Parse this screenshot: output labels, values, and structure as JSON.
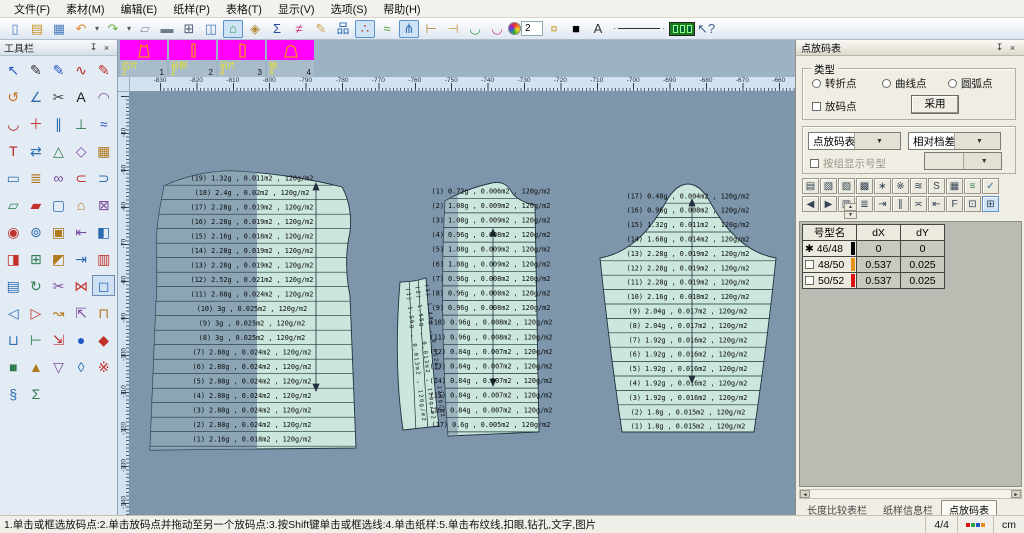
{
  "menu_bar": {
    "items": [
      "文件(F)",
      "素材(M)",
      "编辑(E)",
      "纸样(P)",
      "表格(T)",
      "显示(V)",
      "选项(S)",
      "帮助(H)"
    ]
  },
  "main_toolbar": {
    "zoom_value": "2",
    "icons": [
      {
        "n": "new-file-icon",
        "g": "▯",
        "c": "#4a7ebb"
      },
      {
        "n": "open-file-icon",
        "g": "▤",
        "c": "#c9972f"
      },
      {
        "n": "save-icon",
        "g": "▦",
        "c": "#4a7ebb"
      },
      {
        "n": "undo-icon",
        "g": "↶",
        "c": "#e08a2e"
      },
      {
        "n": "undo-dropdown-icon",
        "g": "▾",
        "c": "#555",
        "narrow": true
      },
      {
        "n": "redo-icon",
        "g": "↷",
        "c": "#74b043"
      },
      {
        "n": "redo-dropdown-icon",
        "g": "▾",
        "c": "#555",
        "narrow": true
      },
      {
        "n": "eraser-icon",
        "g": "▱",
        "c": "#8a97a5"
      },
      {
        "n": "plotter-icon",
        "g": "▬",
        "c": "#6b7b8c"
      },
      {
        "n": "grid-table-icon",
        "g": "⊞",
        "c": "#51617a"
      },
      {
        "n": "pattern-window-icon",
        "g": "◫",
        "c": "#4a7ebb"
      },
      {
        "n": "work-piece-icon",
        "g": "⌂",
        "c": "#2f9e44",
        "sel": true
      },
      {
        "n": "lock-icon",
        "g": "◈",
        "c": "#b08c3a"
      },
      {
        "n": "sum-icon",
        "g": "Σ",
        "c": "#2b4c9b"
      },
      {
        "n": "color-lines-icon",
        "g": "≠",
        "c": "#d63384"
      },
      {
        "n": "brush-icon",
        "g": "✎",
        "c": "#caa24a"
      },
      {
        "n": "tree-chart-icon",
        "g": "品",
        "c": "#2b6cb0"
      },
      {
        "n": "point-plot-icon",
        "g": "∴",
        "c": "#c2302a",
        "sel": true
      },
      {
        "n": "curve-lines-icon",
        "g": "≈",
        "c": "#5f9e44"
      },
      {
        "n": "drill-tool-icon",
        "g": "⋔",
        "c": "#2b6cb0",
        "sel": true
      },
      {
        "n": "measure-a-icon",
        "g": "⊢",
        "c": "#b08c3a"
      },
      {
        "n": "measure-b-icon",
        "g": "⊣",
        "c": "#caa24a"
      },
      {
        "n": "u-curve-icon",
        "g": "◡",
        "c": "#2f9e44"
      },
      {
        "n": "u-curve2-icon",
        "g": "◡",
        "c": "#d63384"
      },
      {
        "n": "color-wheel-icon",
        "special": "wheel"
      },
      {
        "n": "zoom-level-input",
        "special": "input"
      },
      {
        "n": "bulb-icon",
        "g": "¤",
        "c": "#c9a227"
      },
      {
        "n": "color-swatch-icon",
        "g": "■",
        "c": "#000000"
      },
      {
        "n": "text-tool-icon",
        "g": "A",
        "c": "#333333"
      },
      {
        "n": "line-style-select",
        "special": "line"
      },
      {
        "n": "film-icon",
        "special": "film"
      },
      {
        "n": "context-help-icon",
        "g": "↖?",
        "c": "#44608c"
      }
    ]
  },
  "tool_palette": {
    "title": "工具栏",
    "icons": [
      {
        "n": "select-arrow-icon",
        "g": "↖",
        "c": "#2457c5"
      },
      {
        "n": "pen-point-icon",
        "g": "✎",
        "c": "#333333"
      },
      {
        "n": "pen-line-icon",
        "g": "✎",
        "c": "#2457c5"
      },
      {
        "n": "wave-curve-icon",
        "g": "∿",
        "c": "#b3261e"
      },
      {
        "n": "red-pencil-icon",
        "g": "✎",
        "c": "#c2302a"
      },
      {
        "n": "rotate-arrow-icon",
        "g": "↺",
        "c": "#d07020"
      },
      {
        "n": "angle-tool-icon",
        "g": "∠",
        "c": "#2b6cb0"
      },
      {
        "n": "scissors-icon",
        "g": "✂",
        "c": "#444444"
      },
      {
        "n": "text-a-icon",
        "g": "A",
        "c": "#1a1a1a"
      },
      {
        "n": "arc-top-icon",
        "g": "◠",
        "c": "#7a4b9e"
      },
      {
        "n": "arc-bottom-icon",
        "g": "◡",
        "c": "#b3261e"
      },
      {
        "n": "add-point-icon",
        "g": "＋",
        "c": "#c2302a"
      },
      {
        "n": "parallel-icon",
        "g": "∥",
        "c": "#2b6cb0"
      },
      {
        "n": "perpendicular-icon",
        "g": "⊥",
        "c": "#2f7d4f"
      },
      {
        "n": "smooth-wave-icon",
        "g": "≈",
        "c": "#2457c5"
      },
      {
        "n": "t-square-icon",
        "g": "T",
        "c": "#b3261e"
      },
      {
        "n": "mirror-swap-icon",
        "g": "⇄",
        "c": "#2b6cb0"
      },
      {
        "n": "triangle-icon",
        "g": "△",
        "c": "#2f7d4f"
      },
      {
        "n": "diamond-icon",
        "g": "◇",
        "c": "#7a4b9e"
      },
      {
        "n": "grid-fill-icon",
        "g": "▦",
        "c": "#b07a1e"
      },
      {
        "n": "rect-tool-icon",
        "g": "▭",
        "c": "#2b6cb0"
      },
      {
        "n": "stack-lines-icon",
        "g": "≣",
        "c": "#b07a1e"
      },
      {
        "n": "infinity-icon",
        "g": "∞",
        "c": "#7a4b9e"
      },
      {
        "n": "subset-left-icon",
        "g": "⊂",
        "c": "#c2302a"
      },
      {
        "n": "subset-right-icon",
        "g": "⊃",
        "c": "#2b6cb0"
      },
      {
        "n": "piece-outline-icon",
        "g": "▱",
        "c": "#2f7d4f"
      },
      {
        "n": "piece-filled-icon",
        "g": "▰",
        "c": "#c2302a"
      },
      {
        "n": "square-tool-icon",
        "g": "▢",
        "c": "#2b6cb0"
      },
      {
        "n": "house-piece-icon",
        "g": "⌂",
        "c": "#b07a1e"
      },
      {
        "n": "boxed-x-icon",
        "g": "⊠",
        "c": "#7a4b9e"
      },
      {
        "n": "target-icon",
        "g": "◉",
        "c": "#c2302a"
      },
      {
        "n": "ring-icon",
        "g": "⊚",
        "c": "#2b6cb0"
      },
      {
        "n": "filled-box-icon",
        "g": "▣",
        "c": "#b07a1e"
      },
      {
        "n": "tab-left-icon",
        "g": "⇤",
        "c": "#7a4b9e"
      },
      {
        "n": "half-left-icon",
        "g": "◧",
        "c": "#2b6cb0"
      },
      {
        "n": "half-right-icon",
        "g": "◨",
        "c": "#c2302a"
      },
      {
        "n": "boxed-plus-icon",
        "g": "⊞",
        "c": "#2f7d4f"
      },
      {
        "n": "half-top-icon",
        "g": "◩",
        "c": "#b07a1e"
      },
      {
        "n": "tab-right-icon",
        "g": "⇥",
        "c": "#2b6cb0"
      },
      {
        "n": "vertical-fill-icon",
        "g": "▥",
        "c": "#c2302a"
      },
      {
        "n": "horizontal-fill-icon",
        "g": "▤",
        "c": "#2b6cb0"
      },
      {
        "n": "refresh-icon",
        "g": "↻",
        "c": "#2f7d4f"
      },
      {
        "n": "cut-pattern-icon",
        "g": "✂",
        "c": "#7a4b9e"
      },
      {
        "n": "join-bowtie-icon",
        "g": "⋈",
        "c": "#c2302a"
      },
      {
        "n": "box-select-icon",
        "g": "◻",
        "c": "#2b6cb0",
        "sel": true
      },
      {
        "n": "tri-left-icon",
        "g": "◁",
        "c": "#2b6cb0"
      },
      {
        "n": "tri-right-icon",
        "g": "▷",
        "c": "#c2302a"
      },
      {
        "n": "squiggle-arrow-icon",
        "g": "↝",
        "c": "#b07a1e"
      },
      {
        "n": "corner-in-icon",
        "g": "⇱",
        "c": "#7a4b9e"
      },
      {
        "n": "cap-icon",
        "g": "⊓",
        "c": "#b07a1e"
      },
      {
        "n": "cup-icon",
        "g": "⊔",
        "c": "#2b6cb0"
      },
      {
        "n": "turnstile-icon",
        "g": "⊢",
        "c": "#2f7d4f"
      },
      {
        "n": "corner-out-icon",
        "g": "⇲",
        "c": "#c2302a"
      },
      {
        "n": "dot-tool-icon",
        "g": "●",
        "c": "#2457c5"
      },
      {
        "n": "diamond-filled-icon",
        "g": "◆",
        "c": "#c2302a"
      },
      {
        "n": "square-filled-icon",
        "g": "■",
        "c": "#2f7d4f"
      },
      {
        "n": "triangle-up-icon",
        "g": "▲",
        "c": "#b07a1e"
      },
      {
        "n": "triangle-down-icon",
        "g": "▽",
        "c": "#7a4b9e"
      },
      {
        "n": "lozenge-icon",
        "g": "◊",
        "c": "#2b6cb0"
      },
      {
        "n": "reference-mark-icon",
        "g": "※",
        "c": "#c2302a"
      },
      {
        "n": "section-icon",
        "g": "§",
        "c": "#2b6cb0"
      },
      {
        "n": "sigma-tool-icon",
        "g": "Σ",
        "c": "#2f7d4f"
      }
    ]
  },
  "piece_thumbnails": {
    "accent": "#ff00ff",
    "items": [
      {
        "label": "后片",
        "shape": "back",
        "left_num": "2",
        "right_num": "1"
      },
      {
        "label": "前侧",
        "shape": "strip",
        "left_num": "2",
        "right_num": "2"
      },
      {
        "label": "前片",
        "shape": "front",
        "left_num": "4",
        "right_num": "3"
      },
      {
        "label": "袖",
        "shape": "sleeve",
        "left_num": "4",
        "right_num": "4"
      }
    ]
  },
  "canvas": {
    "bg": "#7e96ab",
    "piece_fill": "#cbe6dd",
    "piece_stroke": "#22313d",
    "h_ruler_labels": [
      "-830",
      "-820",
      "-810",
      "-800",
      "-790",
      "-780",
      "-770",
      "-760",
      "-750",
      "-740",
      "-730",
      "-720",
      "-710",
      "-700",
      "-690",
      "-680",
      "-670",
      "-660"
    ],
    "v_ruler_labels": [
      "-40",
      "-50",
      "-60",
      "-70",
      "-80",
      "-90",
      "-100",
      "-110",
      "-120",
      "-130",
      "-140"
    ],
    "back_piece_rows": [
      "(19) 1.32g , 0.011m2 , 120g/m2",
      "(18) 2.4g , 0.02m2 , 120g/m2",
      "(17) 2.28g , 0.019m2 , 120g/m2",
      "(16) 2.28g , 0.019m2 , 120g/m2",
      "(15) 2.16g , 0.018m2 , 120g/m2",
      "(14) 2.28g , 0.019m2 , 120g/m2",
      "(13) 2.28g , 0.019m2 , 120g/m2",
      "(12) 2.52g , 0.021m2 , 120g/m2",
      "(11) 2.88g , 0.024m2 , 120g/m2",
      "(10) 3g , 0.025m2 , 120g/m2",
      "(9) 3g , 0.025m2 , 120g/m2",
      "(8) 3g , 0.025m2 , 120g/m2",
      "(7) 2.88g , 0.024m2 , 120g/m2",
      "(6) 2.88g , 0.024m2 , 120g/m2",
      "(5) 2.88g , 0.024m2 , 120g/m2",
      "(4) 2.88g , 0.024m2 , 120g/m2",
      "(3) 2.88g , 0.024m2 , 120g/m2",
      "(2) 2.88g , 0.024m2 , 120g/m2",
      "(1) 2.16g , 0.018m2 , 120g/m2"
    ],
    "front_piece_rows": [
      "(1) 0.72g , 0.006m2 , 120g/m2",
      "(2) 1.08g , 0.009m2 , 120g/m2",
      "(3) 1.08g , 0.009m2 , 120g/m2",
      "(4) 0.96g , 0.008m2 , 120g/m2",
      "(5) 1.08g , 0.009m2 , 120g/m2",
      "(6) 1.08g , 0.009m2 , 120g/m2",
      "(7) 0.96g , 0.008m2 , 120g/m2",
      "(8) 0.96g , 0.008m2 , 120g/m2",
      "(9) 0.96g , 0.008m2 , 120g/m2",
      "(10) 0.96g , 0.008m2 , 120g/m2",
      "(11) 0.96g , 0.008m2 , 120g/m2",
      "(12) 0.84g , 0.007m2 , 120g/m2",
      "(13) 0.84g , 0.007m2 , 120g/m2",
      "(14) 0.84g , 0.007m2 , 120g/m2",
      "(15) 0.84g , 0.007m2 , 120g/m2",
      "(16) 0.84g , 0.007m2 , 120g/m2",
      "(17) 0.6g , 0.005m2 , 120g/m2"
    ],
    "sleeve_rows": [
      "(17) 0.48g , 0.004m2 , 120g/m2",
      "(16) 0.96g , 0.008m2 , 120g/m2",
      "(15) 1.32g , 0.011m2 , 120g/m2",
      "(14) 1.68g , 0.014m2 , 120g/m2",
      "(13) 2.28g , 0.019m2 , 120g/m2",
      "(12) 2.28g , 0.019m2 , 120g/m2",
      "(11) 2.28g , 0.019m2 , 120g/m2",
      "(10) 2.16g , 0.018m2 , 120g/m2",
      "(9) 2.04g , 0.017m2 , 120g/m2",
      "(8) 2.04g , 0.017m2 , 120g/m2",
      "(7) 1.92g , 0.016m2 , 120g/m2",
      "(6) 1.92g , 0.016m2 , 120g/m2",
      "(5) 1.92g , 0.016m2 , 120g/m2",
      "(4) 1.92g , 0.016m2 , 120g/m2",
      "(3) 1.92g , 0.016m2 , 120g/m2",
      "(2) 1.8g , 0.015m2 , 120g/m2",
      "(1) 1.8g , 0.015m2 , 120g/m2"
    ],
    "side_strip_labels": [
      "(1) 1.56g , 0.013m2 , 120g/m2",
      "(2) 1.56g , 0.013m2 , 120g/m2",
      "(1) 1.44g , 0.012m2 , 120g/m2"
    ]
  },
  "grading_panel": {
    "title": "点放码表",
    "type_group": {
      "label": "类型",
      "radios": [
        "转折点",
        "曲线点",
        "圆弧点"
      ],
      "checkbox": "放码点",
      "apply_button": "采用"
    },
    "combo1": "点放码表",
    "combo2": "相对档差",
    "group_checkbox": "按组显示号型",
    "toolbar_row1": [
      {
        "n": "copy-grade-icon",
        "g": "▤"
      },
      {
        "n": "copy-x-grade-icon",
        "g": "▧"
      },
      {
        "n": "copy-y-grade-icon",
        "g": "▨"
      },
      {
        "n": "paste-grade-icon",
        "g": "▩"
      },
      {
        "n": "swap-grade-icon",
        "g": "∗"
      },
      {
        "n": "spread-all-icon",
        "g": "※"
      },
      {
        "n": "spread-partial-icon",
        "g": "≋"
      },
      {
        "n": "size-lock-icon",
        "g": "S"
      },
      {
        "n": "grade-grid-icon",
        "g": "▦"
      },
      {
        "n": "grade-list-icon",
        "g": "≡",
        "c": "#2f7d4f"
      },
      {
        "n": "grade-check-icon",
        "g": "✓",
        "c": "#2b6cb0"
      }
    ],
    "toolbar_row2": [
      {
        "n": "prev-size-icon",
        "g": "◀"
      },
      {
        "n": "next-size-icon",
        "g": "▶"
      },
      {
        "n": "equal-spacing-icon",
        "g": "▥"
      },
      {
        "n": "align-lines-icon",
        "g": "≣"
      },
      {
        "n": "shift-right-icon",
        "g": "⇥"
      },
      {
        "n": "parallel-grade-icon",
        "g": "∥"
      },
      {
        "n": "balance-icon",
        "g": "≍"
      },
      {
        "n": "shift-left-icon",
        "g": "⇤"
      },
      {
        "n": "formula-icon",
        "g": "F"
      },
      {
        "n": "angle-grade-icon",
        "g": "⊡"
      },
      {
        "n": "point-display-icon",
        "g": "⊞",
        "sel": true
      }
    ],
    "spinner_name": "value-stepper",
    "table": {
      "headers": [
        "号型名",
        "dX",
        "dY"
      ],
      "rows": [
        {
          "size": "46/48",
          "marker": "base",
          "chip": "#000000",
          "dx": "0",
          "dy": "0"
        },
        {
          "size": "48/50",
          "marker": "check",
          "chip": "#e8901c",
          "dx": "0.537",
          "dy": "0.025"
        },
        {
          "size": "50/52",
          "marker": "check",
          "chip": "#dd1111",
          "dx": "0.537",
          "dy": "0.025"
        }
      ]
    },
    "bottom_tabs": [
      {
        "label": "长度比较表栏",
        "active": false
      },
      {
        "label": "纸样信息栏",
        "active": false
      },
      {
        "label": "点放码表",
        "active": true
      }
    ]
  },
  "status_bar": {
    "hint": "1.单击或框选放码点:2.单击放码点并拖动至另一个放码点:3.按Shift键单击或框选线:4.单击纸样:5.单击布纹线,扣眼,钻孔,文字,图片",
    "page": "4/4",
    "unit": "cm",
    "size_colors": [
      "#dd1111",
      "#2f9e44",
      "#2457c5",
      "#e8901c"
    ]
  }
}
